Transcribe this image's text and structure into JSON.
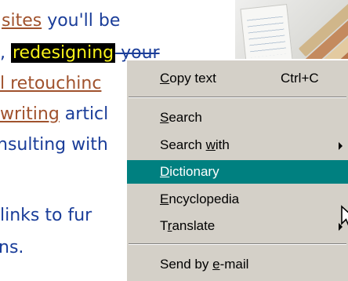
{
  "document": {
    "line1": {
      "link": "sites",
      "text": " you'll be"
    },
    "line2": {
      "prefix": ", ",
      "highlight": "redesigning",
      "text": " your"
    },
    "line3": {
      "link": "l retouchinc"
    },
    "line4": {
      "link": "writing",
      "text": " articl"
    },
    "line5": {
      "text": "nsulting with"
    },
    "line6": {
      "text": " links to fur"
    },
    "line7": {
      "text": "ns."
    }
  },
  "context_menu": {
    "items": [
      {
        "pre": "",
        "key": "C",
        "post": "opy text",
        "shortcut": "Ctrl+C",
        "submenu": false
      },
      {
        "pre": "",
        "key": "S",
        "post": "earch",
        "shortcut": "",
        "submenu": false
      },
      {
        "pre": "Search ",
        "key": "w",
        "post": "ith",
        "shortcut": "",
        "submenu": true
      },
      {
        "pre": "",
        "key": "D",
        "post": "ictionary",
        "shortcut": "",
        "submenu": false,
        "selected": true
      },
      {
        "pre": "",
        "key": "E",
        "post": "ncyclopedia",
        "shortcut": "",
        "submenu": false
      },
      {
        "pre": "T",
        "key": "r",
        "post": "anslate",
        "shortcut": "",
        "submenu": true
      },
      {
        "pre": "Send by ",
        "key": "e",
        "post": "-mail",
        "shortcut": "",
        "submenu": false
      }
    ]
  },
  "colors": {
    "text": "#1a3d99",
    "link": "#a0522d",
    "highlight_bg": "#000000",
    "highlight_fg": "#f7f21a",
    "menu_bg": "#d4d0c8",
    "menu_selected": "#008080"
  },
  "icons": {
    "cursor": "arrow-cursor-icon",
    "submenu": "triangle-right-icon"
  }
}
